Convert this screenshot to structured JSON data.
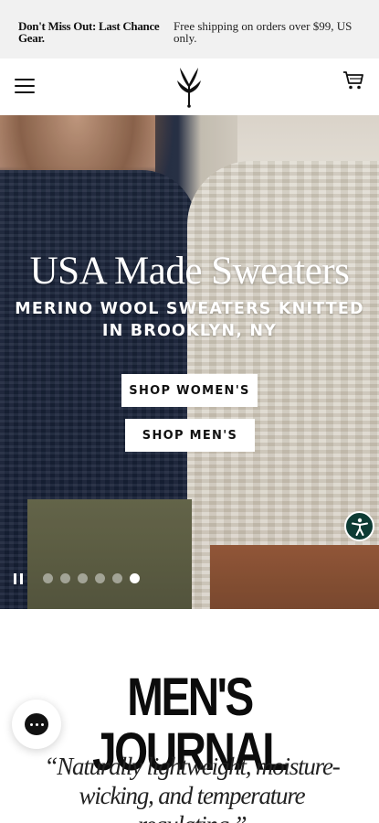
{
  "announcement": {
    "left_text": "Don't Miss Out: Last Chance Gear.",
    "right_text": "Free shipping on orders over $99, US only."
  },
  "header": {
    "menu_icon": "hamburger-menu-icon",
    "logo": "brand-logo",
    "cart_icon": "shopping-cart-icon"
  },
  "hero": {
    "title": "USA Made Sweaters",
    "subtitle": "MERINO WOOL SWEATERS KNITTED IN BROOKLYN, NY",
    "btn_women": "SHOP WOMEN'S",
    "btn_men": "SHOP MEN'S",
    "slides_total": 6,
    "slide_active": 6,
    "pause_icon": "pause-icon"
  },
  "accessibility": {
    "icon": "accessibility-icon"
  },
  "press": {
    "logo_text": "MEN'S JOURNAL",
    "quote": "“Naturally lightweight, moisture-wicking, and temperature regulating.”"
  },
  "chat": {
    "icon": "chat-icon"
  },
  "colors": {
    "announce_bg": "#f1f1f1",
    "accessibility_bg": "#0d3b34",
    "button_bg": "#ffffff"
  }
}
